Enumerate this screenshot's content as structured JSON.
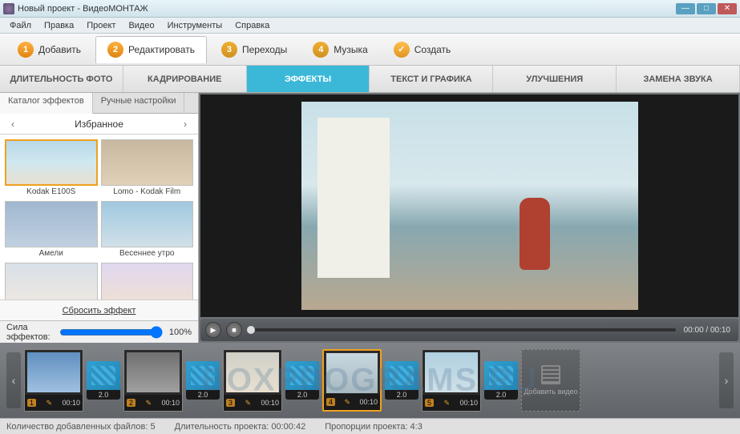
{
  "window": {
    "title": "Новый проект - ВидеоМОНТАЖ"
  },
  "menu": [
    "Файл",
    "Правка",
    "Проект",
    "Видео",
    "Инструменты",
    "Справка"
  ],
  "steps": [
    {
      "num": "1",
      "label": "Добавить"
    },
    {
      "num": "2",
      "label": "Редактировать"
    },
    {
      "num": "3",
      "label": "Переходы"
    },
    {
      "num": "4",
      "label": "Музыка"
    },
    {
      "num": "✓",
      "label": "Создать"
    }
  ],
  "subtabs": [
    "ДЛИТЕЛЬНОСТЬ ФОТО",
    "КАДРИРОВАНИЕ",
    "ЭФФЕКТЫ",
    "ТЕКСТ И ГРАФИКА",
    "УЛУЧШЕНИЯ",
    "ЗАМЕНА ЗВУКА"
  ],
  "sidebar": {
    "tabs": [
      "Каталог эффектов",
      "Ручные настройки"
    ],
    "category": "Избранное",
    "effects": [
      "Kodak E100S",
      "Lomo - Kodak Film",
      "Амели",
      "Весеннее утро",
      "",
      ""
    ],
    "reset": "Сбросить эффект",
    "strength_label": "Сила эффектов:",
    "strength_value": "100%"
  },
  "player": {
    "time": "00:00 / 00:10"
  },
  "timeline": {
    "clips": [
      {
        "idx": "1",
        "dur": "00:10"
      },
      {
        "idx": "2",
        "dur": "00:10"
      },
      {
        "idx": "3",
        "dur": "00:10"
      },
      {
        "idx": "4",
        "dur": "00:10"
      },
      {
        "idx": "5",
        "dur": "00:10"
      }
    ],
    "trans_dur": "2.0",
    "add_label": "Добавить видео"
  },
  "status": {
    "files": "Количество добавленных файлов: 5",
    "duration": "Длительность проекта:   00:00:42",
    "ratio": "Пропорции проекта:   4:3"
  },
  "watermark": "BOXPROGRAMS.RU"
}
